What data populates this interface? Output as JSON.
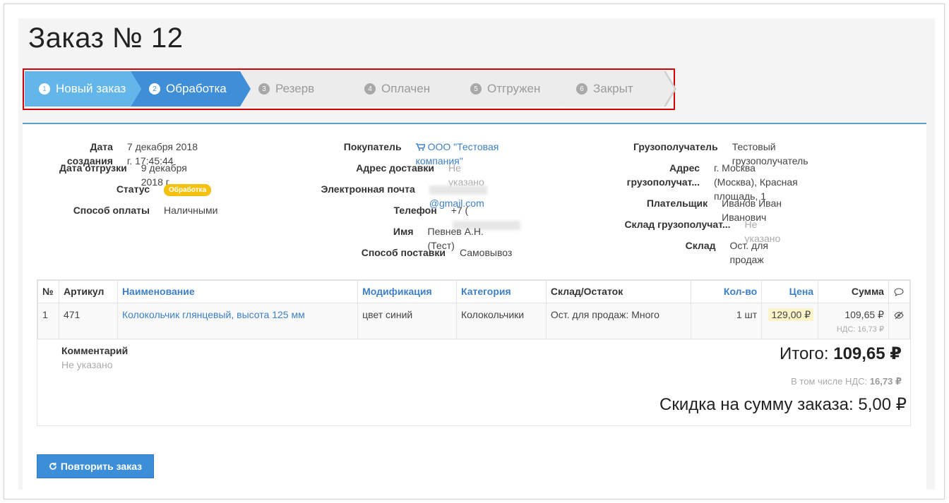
{
  "title": "Заказ № 12",
  "steps": [
    {
      "num": "1",
      "label": "Новый заказ",
      "state": "done"
    },
    {
      "num": "2",
      "label": "Обработка",
      "state": "active"
    },
    {
      "num": "3",
      "label": "Резерв",
      "state": "pending"
    },
    {
      "num": "4",
      "label": "Оплачен",
      "state": "pending"
    },
    {
      "num": "5",
      "label": "Отгружен",
      "state": "pending"
    },
    {
      "num": "6",
      "label": "Закрыт",
      "state": "pending"
    }
  ],
  "info_left": {
    "created_label": "Дата создания",
    "created_value": "7 декабря 2018 г. 17:45:44",
    "shipped_label": "Дата отгрузки",
    "shipped_value": "9 декабря 2018 г.",
    "status_label": "Статус",
    "status_value": "Обработка",
    "payment_label": "Способ оплаты",
    "payment_value": "Наличными"
  },
  "info_mid": {
    "buyer_label": "Покупатель",
    "buyer_value": "ООО \"Тестовая компания\"",
    "address_label": "Адрес доставки",
    "address_value": "Не указано",
    "email_label": "Электронная почта",
    "email_value": "@gmail.com",
    "phone_label": "Телефон",
    "phone_value": "+7 (",
    "name_label": "Имя",
    "name_value": "Певнев А.Н. (Тест)",
    "delivery_label": "Способ поставки",
    "delivery_value": "Самовывоз"
  },
  "info_right": {
    "consignee_label": "Грузополучатель",
    "consignee_value": "Тестовый грузополучатель",
    "consignee_addr_label": "Адрес грузополучат...",
    "consignee_addr_value1": "г. Москва (Москва), Красная",
    "consignee_addr_value2": "площадь, 1",
    "payer_label": "Плательщик",
    "payer_value": "Иванов Иван Иванович",
    "consignee_wh_label": "Склад грузополучат...",
    "consignee_wh_value": "Не указано",
    "warehouse_label": "Склад",
    "warehouse_value": "Ост. для продаж"
  },
  "table": {
    "headers": {
      "num": "№",
      "sku": "Артикул",
      "name": "Наименование",
      "mod": "Модификация",
      "cat": "Категория",
      "stock": "Склад/Остаток",
      "qty": "Кол-во",
      "price": "Цена",
      "sum": "Сумма"
    },
    "rows": [
      {
        "num": "1",
        "sku": "471",
        "name": "Колокольчик глянцевый, высота 125 мм",
        "mod": "цвет синий",
        "cat": "Колокольчики",
        "stock": "Ост. для продаж: Много",
        "qty": "1 шт",
        "price": "129,00 ₽",
        "sum": "109,65 ₽",
        "vat": "НДС: 16,73 ₽"
      }
    ]
  },
  "summary": {
    "comment_label": "Комментарий",
    "comment_value": "Не указано",
    "total_label": "Итого:",
    "total_value": "109,65 ₽",
    "vat_label": "В том числе НДС:",
    "vat_value": "16,73 ₽",
    "discount": "Скидка на сумму заказа: 5,00 ₽"
  },
  "repeat_button": "Повторить заказ",
  "colors": {
    "accent": "#3c8ed9",
    "step_done": "#63b6e9",
    "step_active": "#3f8ed8",
    "badge": "#f4c20e",
    "highlight_border": "#d40000"
  }
}
